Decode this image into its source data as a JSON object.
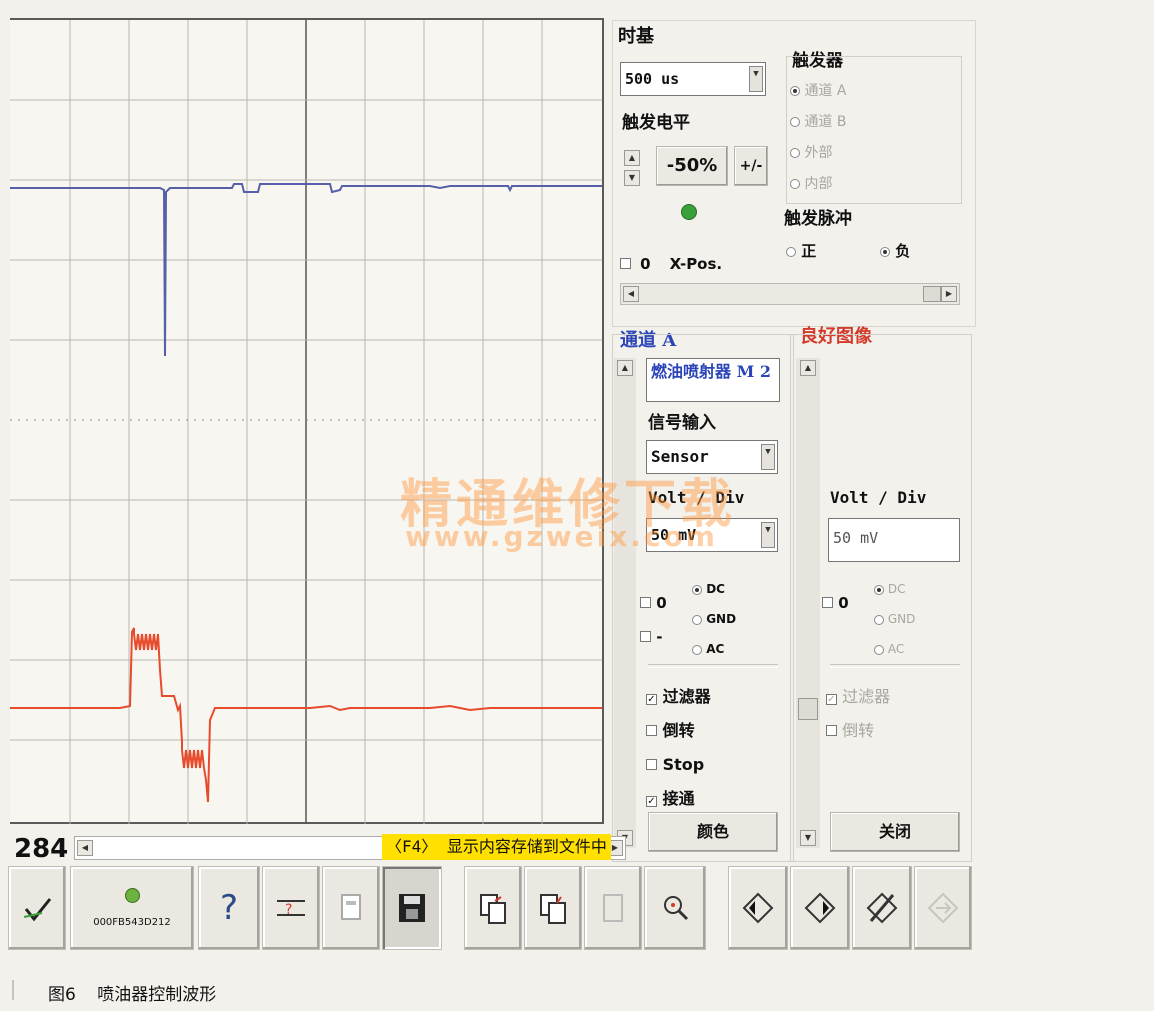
{
  "timebase": {
    "title": "时基",
    "value": "500 us"
  },
  "trigger": {
    "title": "触发器",
    "options": [
      "通道 A",
      "通道 B",
      "外部",
      "内部"
    ],
    "selected": "通道 A"
  },
  "trigger_level": {
    "title": "触发电平",
    "value": "-50%",
    "toggle_label": "+/-"
  },
  "trigger_pulse": {
    "title": "触发脉冲",
    "positive": "正",
    "negative": "负",
    "selected": "负"
  },
  "xpos": {
    "checkbox_value": "0",
    "label": "X-Pos."
  },
  "channel_a": {
    "title": "通道 A",
    "name": "燃油喷射器 M 2",
    "signal_label": "信号输入",
    "signal_value": "Sensor",
    "volt_label": "Volt / Div",
    "volt_value": "50 mV",
    "offset_value": "0",
    "offset_minus": "-",
    "coupling": [
      "DC",
      "GND",
      "AC"
    ],
    "coupling_selected": "DC",
    "filter_label": "过滤器",
    "filter_checked": true,
    "invert_label": "倒转",
    "invert_checked": false,
    "stop_label": "Stop",
    "stop_checked": false,
    "connect_label": "接通",
    "connect_checked": true,
    "color_button": "颜色"
  },
  "channel_b": {
    "title": "良好图像",
    "volt_label": "Volt / Div",
    "volt_value": "50 mV",
    "offset_value": "0",
    "coupling": [
      "DC",
      "GND",
      "AC"
    ],
    "filter_label": "过滤器",
    "invert_label": "倒转",
    "close_button": "关闭"
  },
  "status": {
    "counter": "284",
    "hint": "〈F4〉 显示内容存储到文件中"
  },
  "toolbar": {
    "device_id": "000FB543D212",
    "buttons": [
      "checkmark-icon",
      "status-led-icon",
      "help-icon",
      "measure-help-icon",
      "print-icon",
      "save-disk-icon",
      "copy-left-icon",
      "copy-right-icon",
      "blank-page-icon",
      "zoom-icon",
      "diamond-left-icon",
      "diamond-right-icon",
      "slash-diamond-icon",
      "arrow-right-icon"
    ]
  },
  "watermark": {
    "line1": "精通维修下载",
    "line2": "www.gzweix.com"
  },
  "caption": {
    "figure": "图6",
    "text": "喷油器控制波形"
  },
  "colors": {
    "trace_a": "#5560a8",
    "trace_b": "#e84a2c",
    "grid": "#b9b6b0"
  }
}
